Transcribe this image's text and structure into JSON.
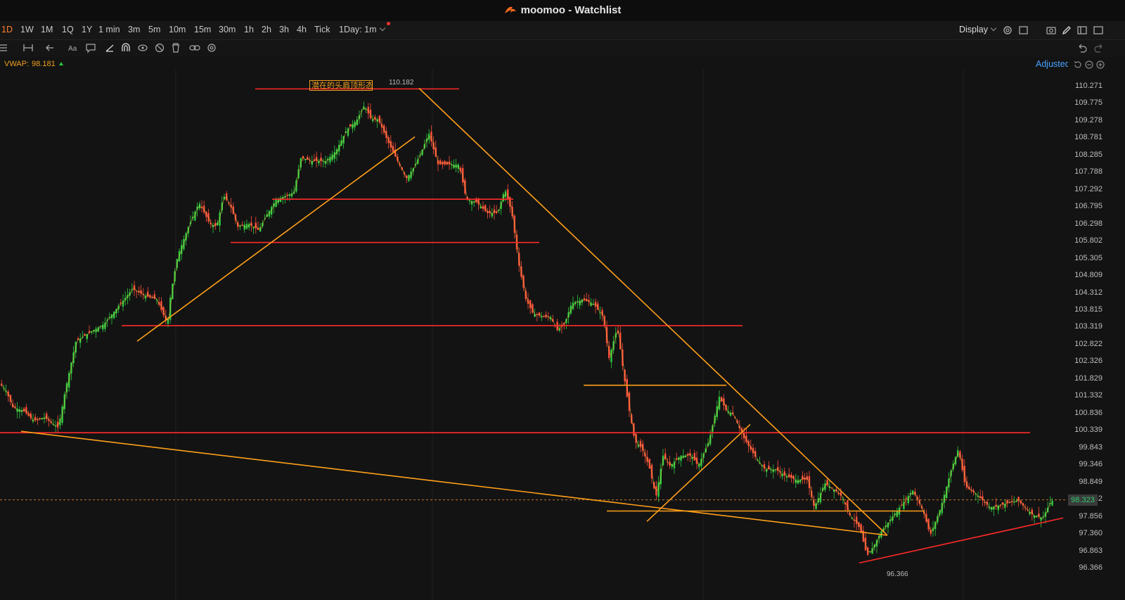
{
  "window": {
    "title": "moomoo - Watchlist"
  },
  "timeframes": [
    "1D",
    "1W",
    "1M",
    "1Q",
    "1Y",
    "1 min",
    "3m",
    "5m",
    "10m",
    "15m",
    "30m",
    "1h",
    "2h",
    "3h",
    "4h",
    "Tick"
  ],
  "timeframe_active": "1D",
  "interval_select": "1Day: 1m",
  "display_label": "Display",
  "indicator": {
    "name": "VWAP:",
    "value": "98.181"
  },
  "adjusted_label": "Adjusted",
  "annotation": {
    "text": "潜在的头肩顶形态",
    "high_label": "110.182",
    "low_label": "96.366"
  },
  "current_price": "98.323",
  "colors": {
    "background": "#131313",
    "candle_up": "#2ecc40",
    "candle_down": "#ff4d3a",
    "support_line": "#ff2a2a",
    "trend_line": "#ff9f1a",
    "accent": "#ff7f2a",
    "link": "#4aa3ff"
  },
  "icons": [
    "list-icon",
    "range-icon",
    "arrow-back-icon",
    "text-icon",
    "comment-icon",
    "draw-line-icon",
    "magnet-icon",
    "eye-icon",
    "hide-icon",
    "delete-icon",
    "link-icon",
    "settings-icon",
    "camera-icon",
    "pencil-icon",
    "layout-icon",
    "undo-icon",
    "redo-icon"
  ],
  "chart_data": {
    "type": "candlestick",
    "ylim": [
      96.366,
      110.271
    ],
    "y_ticks": [
      "110.271",
      "109.775",
      "109.278",
      "108.781",
      "108.285",
      "107.788",
      "107.292",
      "106.795",
      "106.298",
      "105.802",
      "105.305",
      "104.809",
      "104.312",
      "103.815",
      "103.319",
      "102.822",
      "102.326",
      "101.829",
      "101.332",
      "100.836",
      "100.339",
      "99.843",
      "99.346",
      "98.849",
      "98.352",
      "97.856",
      "97.360",
      "96.863",
      "96.366"
    ],
    "price_path": [
      [
        0,
        101.7
      ],
      [
        10,
        101.5
      ],
      [
        20,
        101.0
      ],
      [
        35,
        100.9
      ],
      [
        50,
        100.6
      ],
      [
        65,
        100.7
      ],
      [
        85,
        100.4
      ],
      [
        95,
        101.5
      ],
      [
        110,
        102.9
      ],
      [
        125,
        103.1
      ],
      [
        150,
        103.4
      ],
      [
        170,
        103.9
      ],
      [
        190,
        104.4
      ],
      [
        210,
        104.2
      ],
      [
        225,
        104.1
      ],
      [
        240,
        103.4
      ],
      [
        245,
        104.3
      ],
      [
        255,
        105.4
      ],
      [
        270,
        106.2
      ],
      [
        285,
        106.9
      ],
      [
        300,
        106.3
      ],
      [
        310,
        106.2
      ],
      [
        320,
        107.1
      ],
      [
        330,
        106.8
      ],
      [
        340,
        106.2
      ],
      [
        355,
        106.3
      ],
      [
        370,
        106.1
      ],
      [
        380,
        106.5
      ],
      [
        395,
        107.0
      ],
      [
        410,
        107.1
      ],
      [
        420,
        107.2
      ],
      [
        430,
        108.2
      ],
      [
        445,
        108.1
      ],
      [
        465,
        108.1
      ],
      [
        480,
        108.4
      ],
      [
        495,
        109.0
      ],
      [
        510,
        109.3
      ],
      [
        520,
        109.7
      ],
      [
        530,
        109.3
      ],
      [
        540,
        109.3
      ],
      [
        555,
        108.6
      ],
      [
        565,
        108.2
      ],
      [
        580,
        107.6
      ],
      [
        590,
        107.9
      ],
      [
        600,
        108.3
      ],
      [
        612,
        108.9
      ],
      [
        625,
        108.0
      ],
      [
        640,
        108.0
      ],
      [
        655,
        108.0
      ],
      [
        665,
        107.0
      ],
      [
        680,
        106.9
      ],
      [
        695,
        106.6
      ],
      [
        710,
        106.6
      ],
      [
        720,
        107.3
      ],
      [
        730,
        106.6
      ],
      [
        740,
        105.1
      ],
      [
        750,
        104.1
      ],
      [
        760,
        103.7
      ],
      [
        775,
        103.6
      ],
      [
        785,
        103.6
      ],
      [
        795,
        103.2
      ],
      [
        805,
        103.4
      ],
      [
        815,
        104.0
      ],
      [
        830,
        104.1
      ],
      [
        845,
        104.0
      ],
      [
        860,
        103.6
      ],
      [
        868,
        102.4
      ],
      [
        880,
        103.3
      ],
      [
        888,
        102.1
      ],
      [
        896,
        101.0
      ],
      [
        905,
        100.0
      ],
      [
        915,
        99.8
      ],
      [
        925,
        99.3
      ],
      [
        935,
        98.4
      ],
      [
        945,
        99.6
      ],
      [
        955,
        99.3
      ],
      [
        970,
        99.6
      ],
      [
        985,
        99.6
      ],
      [
        995,
        99.3
      ],
      [
        1010,
        100.0
      ],
      [
        1025,
        101.3
      ],
      [
        1035,
        100.9
      ],
      [
        1045,
        100.8
      ],
      [
        1060,
        100.1
      ],
      [
        1075,
        99.6
      ],
      [
        1090,
        99.2
      ],
      [
        1105,
        99.2
      ],
      [
        1120,
        99.0
      ],
      [
        1135,
        98.9
      ],
      [
        1150,
        98.9
      ],
      [
        1160,
        98.1
      ],
      [
        1175,
        98.8
      ],
      [
        1190,
        98.6
      ],
      [
        1200,
        98.4
      ],
      [
        1210,
        97.9
      ],
      [
        1225,
        97.5
      ],
      [
        1235,
        96.7
      ],
      [
        1245,
        97.0
      ],
      [
        1255,
        97.4
      ],
      [
        1270,
        97.8
      ],
      [
        1285,
        98.2
      ],
      [
        1300,
        98.6
      ],
      [
        1315,
        98.0
      ],
      [
        1325,
        97.3
      ],
      [
        1340,
        98.1
      ],
      [
        1355,
        99.2
      ],
      [
        1365,
        99.8
      ],
      [
        1375,
        98.7
      ],
      [
        1390,
        98.5
      ],
      [
        1410,
        98.1
      ],
      [
        1430,
        98.2
      ],
      [
        1450,
        98.3
      ],
      [
        1470,
        97.9
      ],
      [
        1485,
        97.8
      ],
      [
        1497,
        98.3
      ]
    ],
    "levels": [
      {
        "price": 110.182,
        "x1": 363,
        "x2": 653,
        "color": "red"
      },
      {
        "price": 107.0,
        "x1": 387,
        "x2": 730,
        "color": "red"
      },
      {
        "price": 105.75,
        "x1": 328,
        "x2": 767,
        "color": "red"
      },
      {
        "price": 103.35,
        "x1": 173,
        "x2": 1056,
        "color": "red"
      },
      {
        "price": 101.63,
        "x1": 830,
        "x2": 1033,
        "color": "orange"
      },
      {
        "price": 100.26,
        "x1": 0,
        "x2": 1465,
        "color": "red"
      },
      {
        "price": 98.0,
        "x1": 863,
        "x2": 1315,
        "color": "orange"
      }
    ],
    "trend_lines": [
      {
        "p1": [
          195,
          102.9
        ],
        "p2": [
          590,
          108.8
        ],
        "color": "orange"
      },
      {
        "p1": [
          596,
          110.2
        ],
        "p2": [
          1262,
          97.3
        ],
        "color": "orange"
      },
      {
        "p1": [
          30,
          100.3
        ],
        "p2": [
          1262,
          97.3
        ],
        "color": "orange"
      },
      {
        "p1": [
          920,
          97.7
        ],
        "p2": [
          1067,
          100.5
        ],
        "color": "orange"
      },
      {
        "p1": [
          1222,
          96.5
        ],
        "p2": [
          1512,
          97.8
        ],
        "color": "red"
      }
    ]
  }
}
